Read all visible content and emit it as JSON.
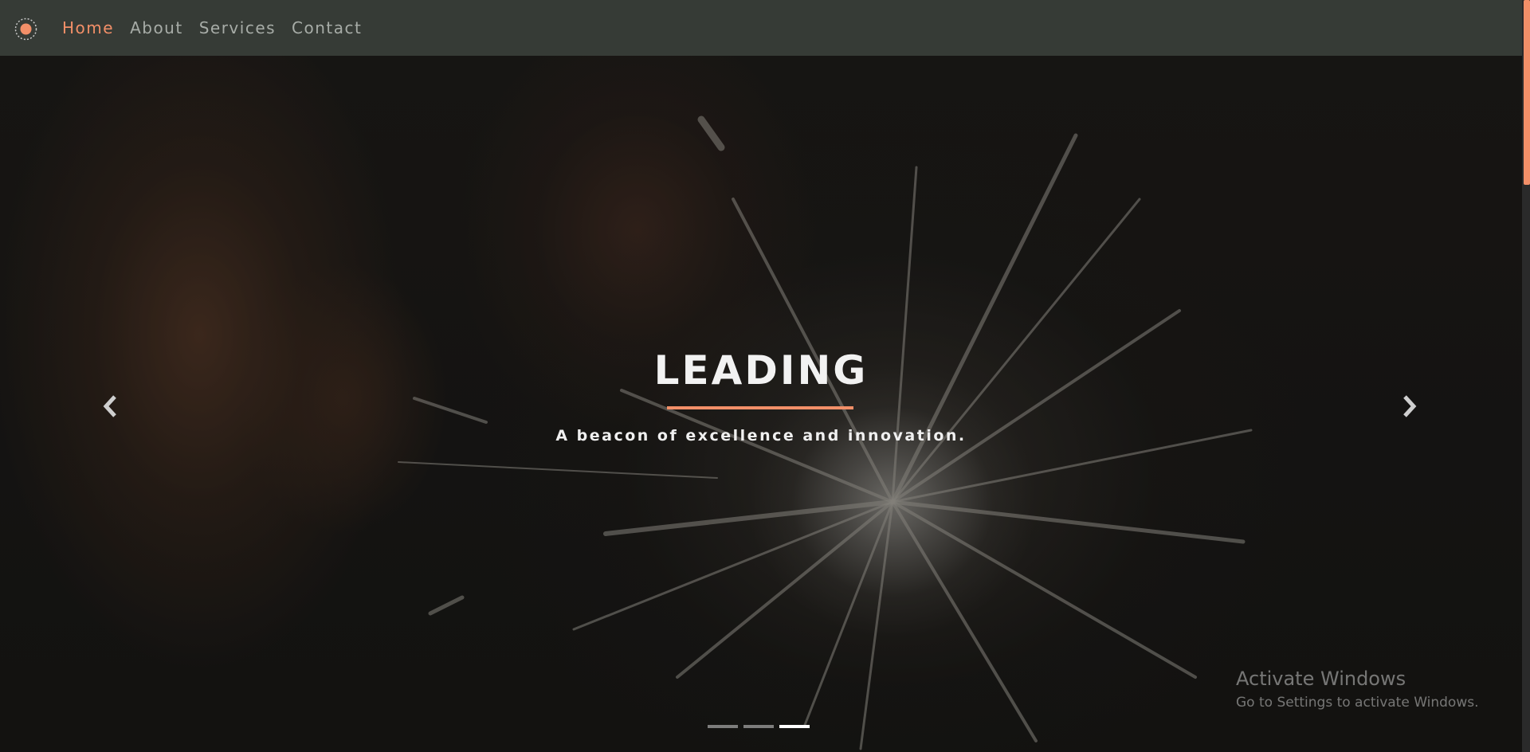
{
  "nav": {
    "logo_icon": "sunburst-logo-icon",
    "items": [
      {
        "label": "Home",
        "active": true
      },
      {
        "label": "About",
        "active": false
      },
      {
        "label": "Services",
        "active": false
      },
      {
        "label": "Contact",
        "active": false
      }
    ]
  },
  "hero": {
    "title": "LEADING",
    "subtitle": "A beacon of excellence and innovation.",
    "prev_icon": "chevron-left-icon",
    "next_icon": "chevron-right-icon",
    "slide_count": 3,
    "active_slide": 3
  },
  "watermark": {
    "title": "Activate Windows",
    "subtitle": "Go to Settings to activate Windows."
  },
  "colors": {
    "accent": "#f28f68",
    "navbar": "#363b36",
    "nav_text": "#a7aca7",
    "hero_text": "#f2f2f2"
  }
}
